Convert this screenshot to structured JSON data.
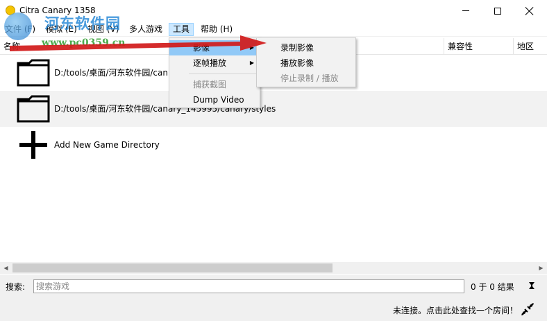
{
  "window": {
    "title": "Citra Canary 1358",
    "min_icon": "minimize-icon",
    "max_icon": "maximize-icon",
    "close_icon": "close-icon"
  },
  "watermark": {
    "title": "河东软件园",
    "url": "www.pc0359.cn"
  },
  "menubar": {
    "items": [
      {
        "label": "文件 (F)"
      },
      {
        "label": "模拟 (E)"
      },
      {
        "label": "视图 (V)"
      },
      {
        "label": "多人游戏"
      },
      {
        "label": "工具"
      },
      {
        "label": "帮助 (H)"
      }
    ]
  },
  "columns": {
    "name": "名称",
    "compatibility": "兼容性",
    "region": "地区"
  },
  "rows": [
    {
      "path": "D:/tools/桌面/河东软件园/can",
      "icon": "folder-icon"
    },
    {
      "path": "D:/tools/桌面/河东软件园/canary_145995/canary/styles",
      "icon": "folder-icon"
    },
    {
      "path": "Add New Game Directory",
      "icon": "plus-icon"
    }
  ],
  "tools_menu": {
    "items": [
      {
        "label": "影像",
        "submenu": true,
        "highlight": true
      },
      {
        "label": "逐帧播放",
        "submenu": true
      },
      {
        "label": "捕获截图",
        "disabled": true
      },
      {
        "label": "Dump Video"
      }
    ]
  },
  "video_submenu": {
    "items": [
      {
        "label": "录制影像"
      },
      {
        "label": "播放影像"
      },
      {
        "label": "停止录制 / 播放",
        "disabled": true
      }
    ]
  },
  "search": {
    "label": "搜索:",
    "placeholder": "搜索游戏",
    "value": "",
    "result": "0 于 0 结果",
    "clear_icon": "clear-filter-icon"
  },
  "status": {
    "text": "未连接。点击此处查找一个房间！",
    "icon": "network-icon"
  },
  "colors": {
    "menu_active": "#cce8ff",
    "submenu_highlight": "#91c9f7",
    "arrow": "#d11a1a",
    "row_alt": "#f2f2f2"
  }
}
